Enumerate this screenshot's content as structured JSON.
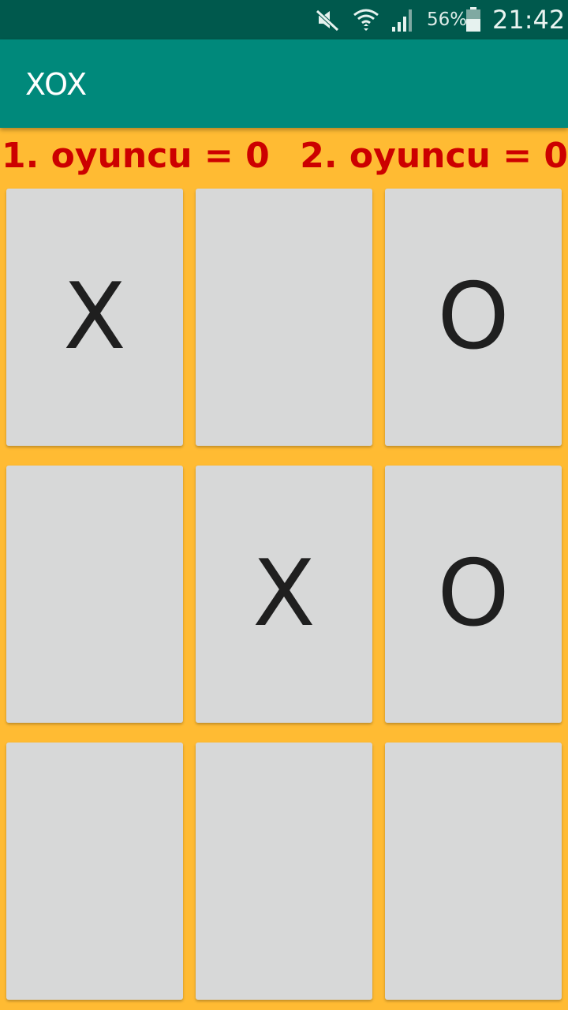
{
  "status_bar": {
    "icons": [
      "mute-icon",
      "wifi-icon",
      "signal-icon",
      "battery-icon"
    ],
    "battery_percent": "56%",
    "time": "21:42"
  },
  "app_bar": {
    "title": "XOX"
  },
  "scores": {
    "player1": "1. oyuncu = 0",
    "player2": "2. oyuncu = 0"
  },
  "board": {
    "cells": [
      "X",
      "",
      "O",
      "",
      "X",
      "O",
      "",
      "",
      ""
    ]
  },
  "colors": {
    "status_bar": "#00594D",
    "app_bar": "#00897B",
    "background": "#FFBB33",
    "score_text": "#CC0000",
    "cell": "#D7D8D8",
    "mark": "#1F1F1F"
  }
}
